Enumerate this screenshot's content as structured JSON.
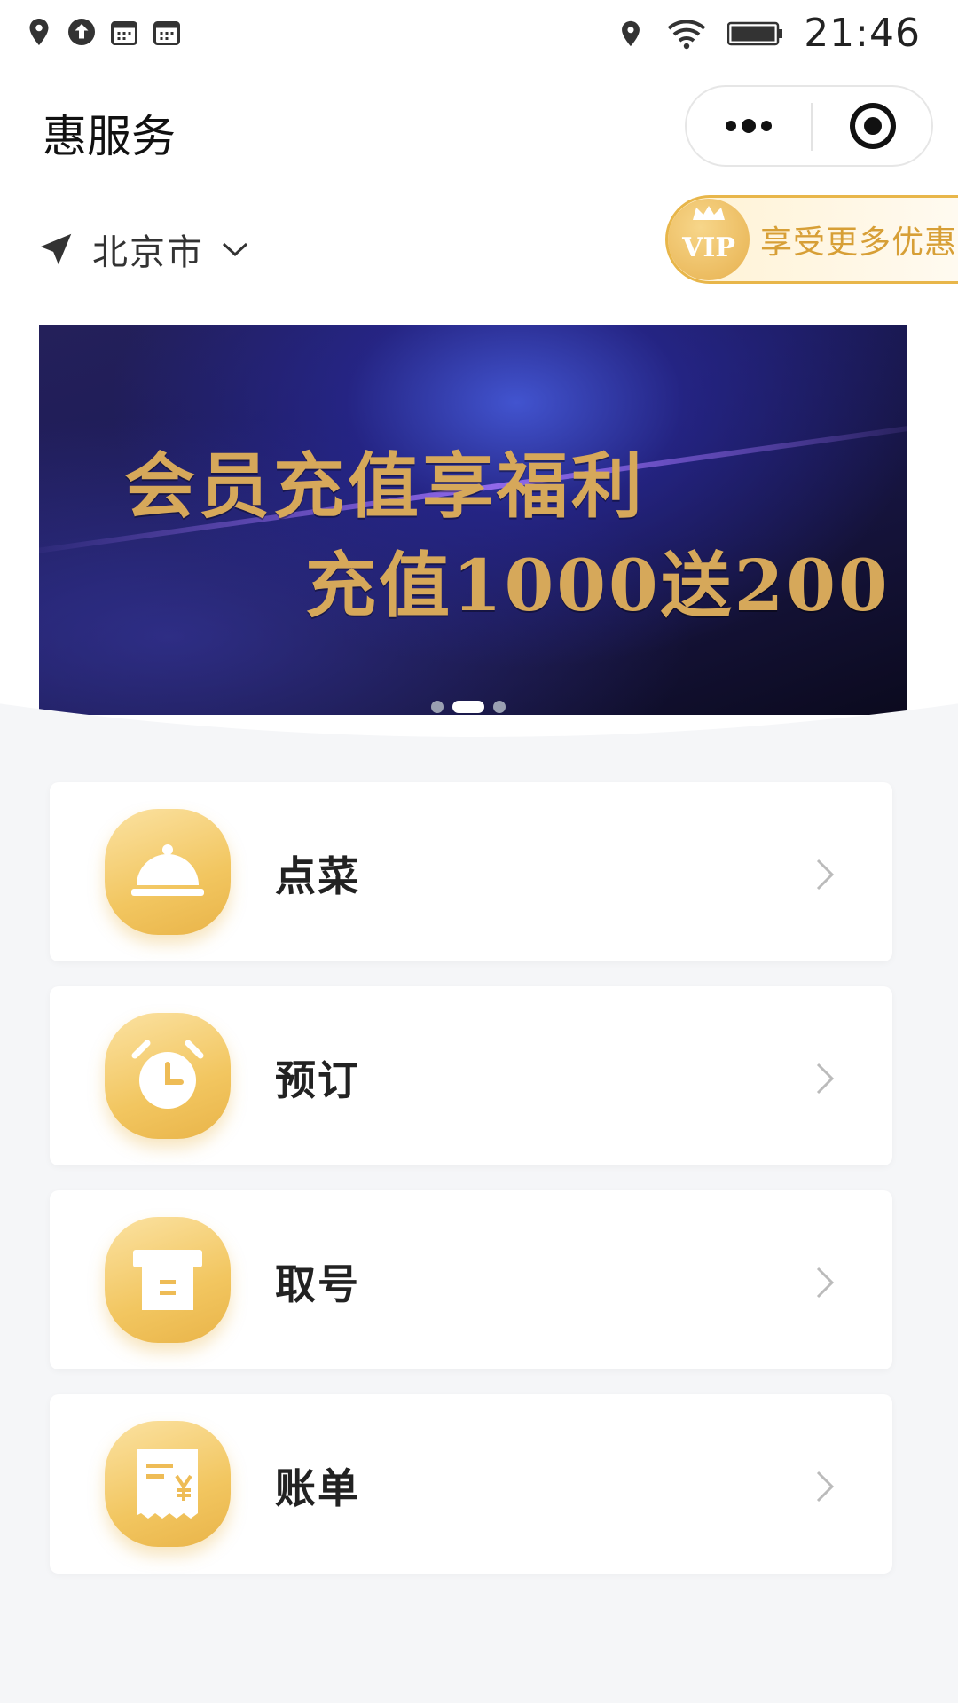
{
  "status_bar": {
    "left_icons": [
      "location-pin-icon",
      "upload-circle-icon",
      "calendar-icon",
      "calendar-icon"
    ],
    "right_icons": [
      "location-pin-icon",
      "wifi-icon",
      "battery-icon"
    ],
    "time": "21:46"
  },
  "header": {
    "title": "惠服务",
    "more_icon": "more-dots-icon",
    "close_icon": "target-circle-icon"
  },
  "location": {
    "city": "北京市",
    "icon": "navigation-arrow-icon",
    "dropdown_icon": "chevron-down-icon"
  },
  "vip": {
    "badge_text": "VIP",
    "label": "享受更多优惠",
    "badge_icon": "crown-icon"
  },
  "banner": {
    "line1": "会员充值享福利",
    "line2": "充值1000送200",
    "dots_count": 3,
    "active_index": 1
  },
  "menu": [
    {
      "label": "点菜",
      "icon": "cloche-icon"
    },
    {
      "label": "预订",
      "icon": "alarm-clock-icon"
    },
    {
      "label": "取号",
      "icon": "ticket-box-icon"
    },
    {
      "label": "账单",
      "icon": "bill-receipt-icon"
    }
  ],
  "colors": {
    "accent_gold": "#e9b449",
    "vip_text": "#d79f36",
    "banner_bg": "#1b1a57"
  }
}
